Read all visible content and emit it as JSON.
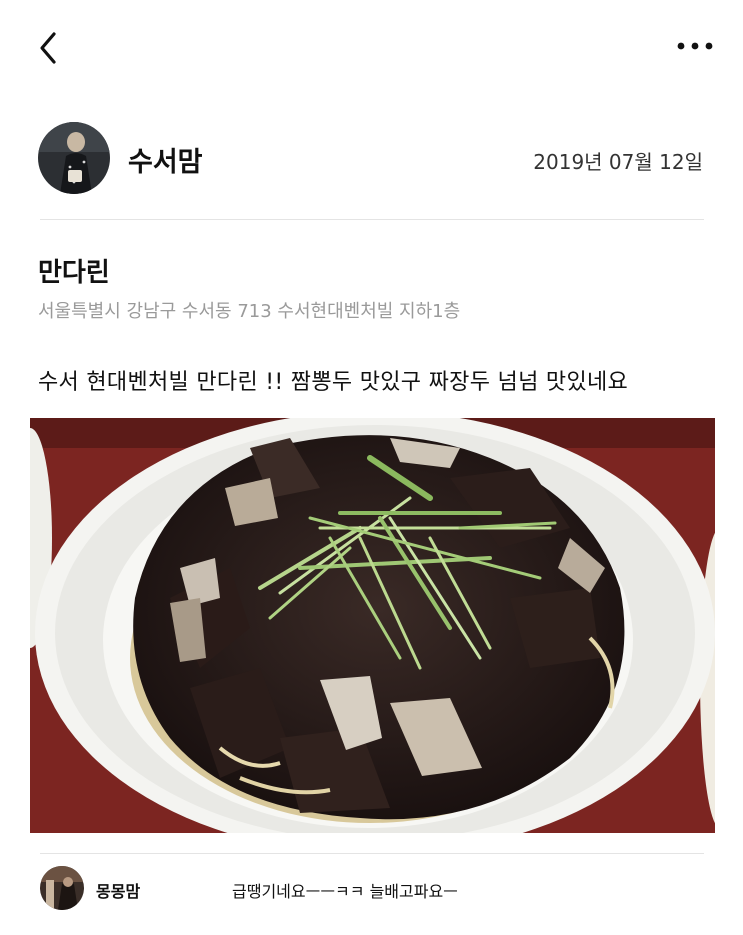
{
  "topbar": {
    "back_icon": "chevron-left-icon",
    "more_icon": "more-horizontal-icon"
  },
  "post": {
    "author": "수서맘",
    "date": "2019년 07월 12일",
    "place_name": "만다린",
    "place_address": "서울특별시 강남구 수서동 713 수서현대벤처빌 지하1층",
    "text": "수서 현대벤처빌 만다린 !!  짬뽕두 맛있구 짜장두  넘넘 맛있네요"
  },
  "comments": [
    {
      "author": "몽몽맘",
      "text": "급땡기네요ㅡㅡㅋㅋ 늘배고파요ㅡ"
    }
  ]
}
